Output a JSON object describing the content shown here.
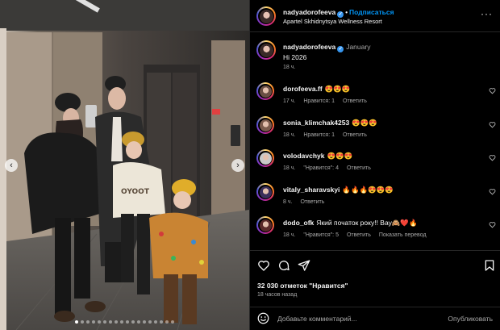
{
  "photo": {
    "prev_icon": "chevron-left-icon",
    "next_icon": "chevron-right-icon",
    "prev_glyph": "‹",
    "next_glyph": "›",
    "slides": 18,
    "active_slide": 1
  },
  "header": {
    "username": "nadyadorofeeva",
    "verified_glyph": "✓",
    "dot": "•",
    "follow_label": "Подписаться",
    "location": "Apartel Skhidnytsya Wellness Resort",
    "more_glyph": "···"
  },
  "caption": {
    "username": "nadyadorofeeva",
    "time": "January",
    "text": "Hi 2026",
    "age": "18 ч."
  },
  "comments": [
    {
      "username": "dorofeeva.ff",
      "text": "😍😍😍",
      "age": "17 ч.",
      "likes": "Нравится: 1",
      "reply": "Ответить",
      "translate": ""
    },
    {
      "username": "sonia_klimchak4253",
      "text": "😍😍😍",
      "age": "18 ч.",
      "likes": "Нравится: 1",
      "reply": "Ответить",
      "translate": ""
    },
    {
      "username": "volodavchyk",
      "text": "😍😍😍",
      "age": "18 ч.",
      "likes": "\"Нравится\": 4",
      "reply": "Ответить",
      "translate": ""
    },
    {
      "username": "vitaly_sharavskyi",
      "text": "🔥🔥🔥😍😍😍",
      "age": "8 ч.",
      "likes": "",
      "reply": "Ответить",
      "translate": ""
    },
    {
      "username": "dodo_ofk",
      "text": "Який початок року!! Вау🙈❤️🔥",
      "age": "18 ч.",
      "likes": "\"Нравится\": 5",
      "reply": "Ответить",
      "translate": "Показать перевод"
    }
  ],
  "actions": {
    "like_icon": "heart-icon",
    "comment_icon": "comment-icon",
    "share_icon": "share-icon",
    "save_icon": "bookmark-icon",
    "likes_text": "32 030 отметок \"Нравится\"",
    "post_age": "18 часов назад"
  },
  "add_comment": {
    "emoji_icon": "emoji-icon",
    "placeholder": "Добавьте комментарий...",
    "publish_label": "Опубликовать"
  },
  "colors": {
    "background": "#000000",
    "link_blue": "#0095f6",
    "secondary_text": "#a8a8a8",
    "divider": "#262626"
  }
}
